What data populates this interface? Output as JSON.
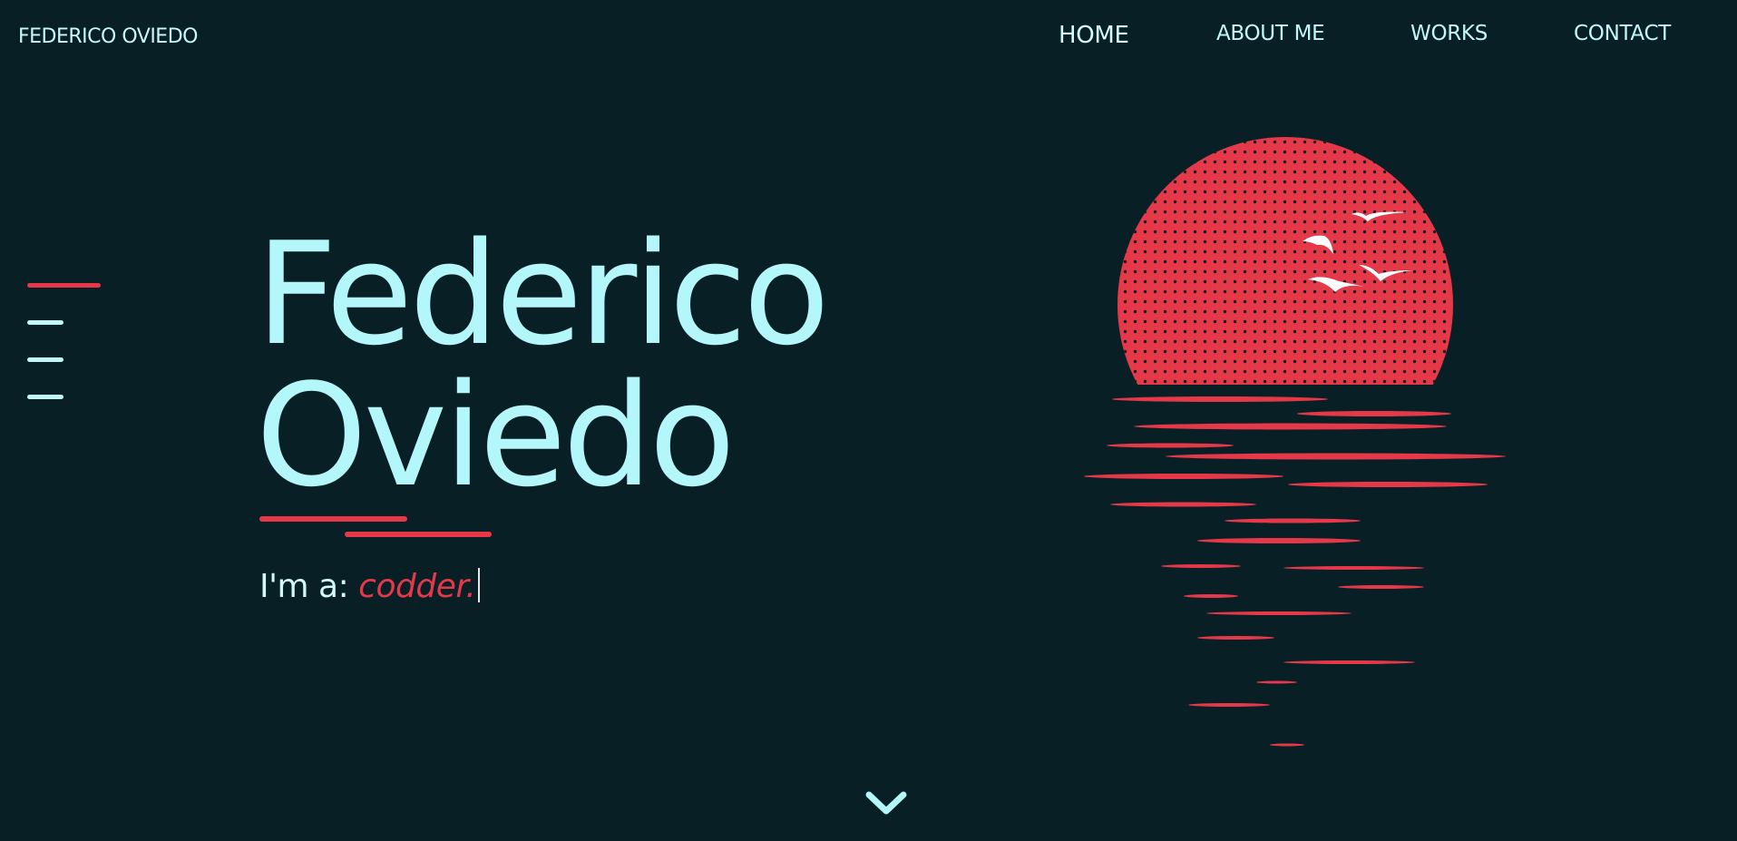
{
  "header": {
    "brand": "FEDERICO OVIEDO",
    "nav": [
      {
        "label": "HOME",
        "active": true
      },
      {
        "label": "ABOUT ME",
        "active": false
      },
      {
        "label": "WORKS",
        "active": false
      },
      {
        "label": "CONTACT",
        "active": false
      }
    ]
  },
  "hero": {
    "first_name": "Federico",
    "last_name": "Oviedo",
    "typing_prefix": "I'm a:",
    "typing_role": "codder."
  },
  "icons": {
    "menu": "hamburger-menu-icon",
    "scroll": "chevron-down-icon",
    "artwork": "sunset-sea-illustration"
  },
  "colors": {
    "background": "#081f26",
    "accent": "#e5394a",
    "text": "#b3f7fa"
  }
}
